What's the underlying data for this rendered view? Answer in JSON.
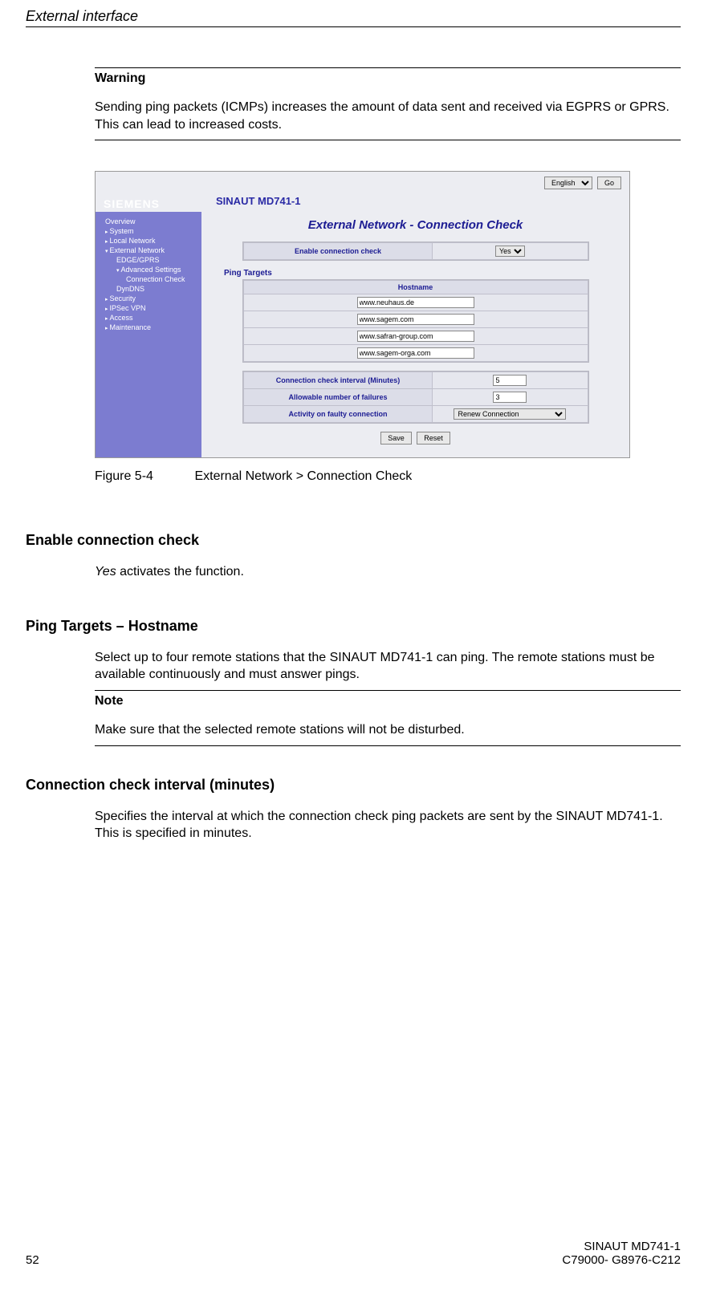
{
  "header": {
    "running_title": "External interface"
  },
  "warning_block": {
    "title": "Warning",
    "text": "Sending ping packets (ICMPs) increases the amount of data sent and received via EGPRS or GPRS. This can lead to increased costs."
  },
  "screenshot": {
    "lang_select": "English",
    "go_btn": "Go",
    "logo": "SIEMENS",
    "product": "SINAUT MD741-1",
    "nav": {
      "overview": "Overview",
      "system": "System",
      "local_network": "Local Network",
      "external_network": "External Network",
      "edge_gprs": "EDGE/GPRS",
      "advanced_settings": "Advanced Settings",
      "connection_check": "Connection Check",
      "dyndns": "DynDNS",
      "security": "Security",
      "ipsec_vpn": "IPSec VPN",
      "access": "Access",
      "maintenance": "Maintenance"
    },
    "page_title": "External Network - Connection Check",
    "enable_label": "Enable connection check",
    "enable_value": "Yes",
    "ping_targets_hdr": "Ping Targets",
    "hostname_hdr": "Hostname",
    "hosts": [
      "www.neuhaus.de",
      "www.sagem.com",
      "www.safran-group.com",
      "www.sagem-orga.com"
    ],
    "interval_label": "Connection check interval (Minutes)",
    "interval_value": "5",
    "failures_label": "Allowable number of failures",
    "failures_value": "3",
    "activity_label": "Activity on faulty connection",
    "activity_value": "Renew Connection",
    "save_btn": "Save",
    "reset_btn": "Reset"
  },
  "figure": {
    "number": "Figure 5-4",
    "caption": "External Network > Connection Check"
  },
  "sections": {
    "enable": {
      "heading": "Enable connection check",
      "text_prefix_italic": "Yes",
      "text_rest": " activates the function."
    },
    "ping": {
      "heading": "Ping Targets – Hostname",
      "text": "Select up to four remote stations that the SINAUT MD741-1 can ping. The remote stations must be available continuously and must answer pings."
    },
    "note": {
      "title": "Note",
      "text": "Make sure that the selected remote stations will not be disturbed."
    },
    "interval": {
      "heading": "Connection check interval (minutes)",
      "text": "Specifies the interval at which the connection check ping packets are sent by the SINAUT MD741-1. This is specified in minutes."
    }
  },
  "footer": {
    "page_no": "52",
    "line1": "SINAUT MD741-1",
    "line2": "C79000- G8976-C212"
  }
}
